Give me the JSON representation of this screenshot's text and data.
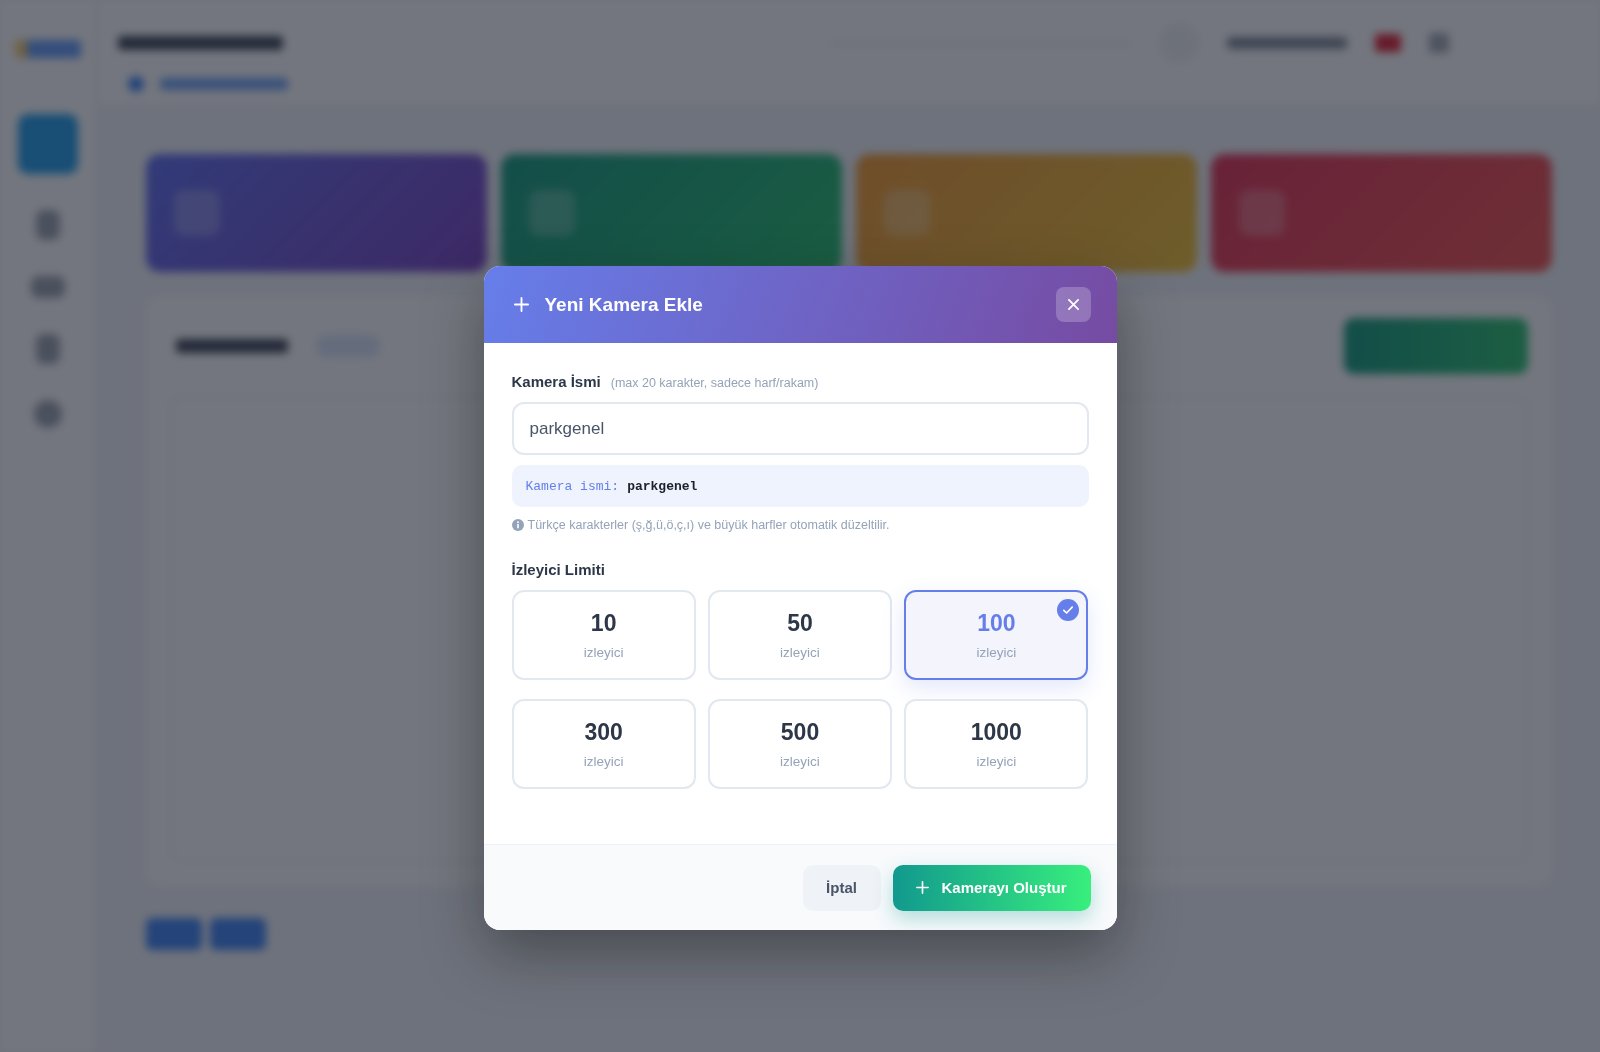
{
  "dialog": {
    "title": "Yeni Kamera Ekle",
    "name_field": {
      "label": "Kamera İsmi",
      "hint": "(max 20 karakter, sadece harf/rakam)",
      "value": "parkgenel"
    },
    "preview": {
      "label": "Kamera ismi:",
      "value": "parkgenel"
    },
    "note": "Türkçe karakterler (ş,ğ,ü,ö,ç,ı) ve büyük harfler otomatik düzeltilir.",
    "limit": {
      "label": "İzleyici Limiti",
      "options": [
        {
          "value": "10",
          "unit": "izleyici",
          "selected": false
        },
        {
          "value": "50",
          "unit": "izleyici",
          "selected": false
        },
        {
          "value": "100",
          "unit": "izleyici",
          "selected": true
        },
        {
          "value": "300",
          "unit": "izleyici",
          "selected": false
        },
        {
          "value": "500",
          "unit": "izleyici",
          "selected": false
        },
        {
          "value": "1000",
          "unit": "izleyici",
          "selected": false
        }
      ]
    },
    "buttons": [
      {
        "kind": "secondary",
        "label": "İptal"
      },
      {
        "kind": "primary",
        "label": "Kamerayı Oluştur"
      }
    ]
  }
}
